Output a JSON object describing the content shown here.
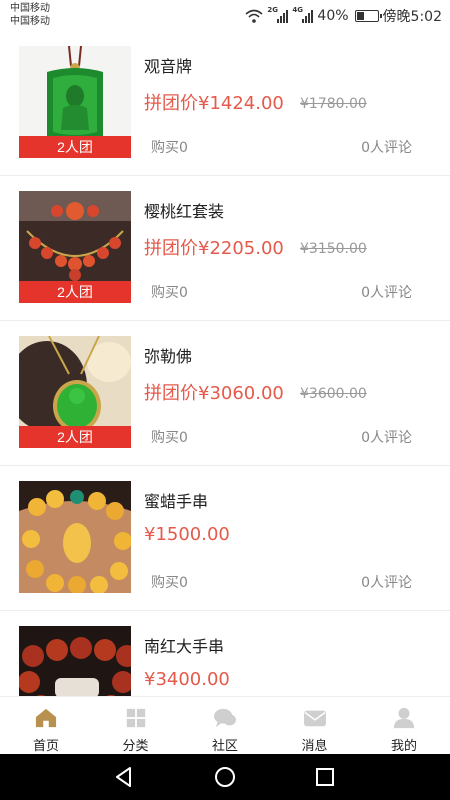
{
  "status_bar": {
    "carrier_1": "中国移动",
    "carrier_2": "中国移动",
    "sig1_tag": "2G",
    "sig2_tag": "4G",
    "battery_percent": "40%",
    "battery_level": 0.4,
    "time": "傍晚5:02"
  },
  "products": [
    {
      "title": "观音牌",
      "price": "拼团价¥1424.00",
      "original_price": "¥1780.00",
      "group_tag": "2人团",
      "bought": "购买0",
      "reviews": "0人评论"
    },
    {
      "title": "樱桃红套装",
      "price": "拼团价¥2205.00",
      "original_price": "¥3150.00",
      "group_tag": "2人团",
      "bought": "购买0",
      "reviews": "0人评论"
    },
    {
      "title": "弥勒佛",
      "price": "拼团价¥3060.00",
      "original_price": "¥3600.00",
      "group_tag": "2人团",
      "bought": "购买0",
      "reviews": "0人评论"
    },
    {
      "title": "蜜蜡手串",
      "price": "¥1500.00",
      "bought": "购买0",
      "reviews": "0人评论"
    },
    {
      "title": "南红大手串",
      "price": "¥3400.00"
    }
  ],
  "bottom_nav": {
    "home": "首页",
    "category": "分类",
    "community": "社区",
    "messages": "消息",
    "mine": "我的",
    "active_color": "#b8914f",
    "inactive_color": "#cfcfcf"
  },
  "colors": {
    "price": "#e55a4b",
    "group_tag": "#e5342c"
  }
}
